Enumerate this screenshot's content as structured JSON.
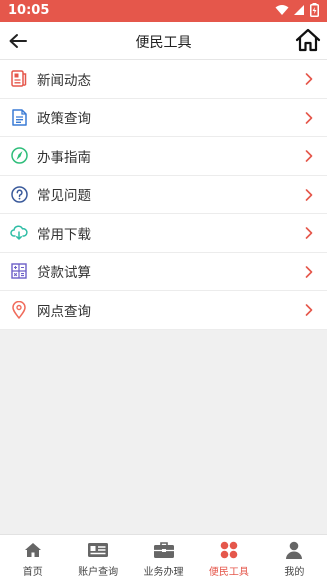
{
  "status": {
    "time": "10:05"
  },
  "header": {
    "title": "便民工具"
  },
  "menu": {
    "items": [
      {
        "label": "新闻动态",
        "icon": "news-icon",
        "color": "#e5574b"
      },
      {
        "label": "政策查询",
        "icon": "document-icon",
        "color": "#3a7bd5"
      },
      {
        "label": "办事指南",
        "icon": "compass-icon",
        "color": "#2ebd7a"
      },
      {
        "label": "常见问题",
        "icon": "question-icon",
        "color": "#3a5a9b"
      },
      {
        "label": "常用下载",
        "icon": "cloud-download-icon",
        "color": "#2ebda5"
      },
      {
        "label": "贷款试算",
        "icon": "calculator-icon",
        "color": "#6c5fc7"
      },
      {
        "label": "网点查询",
        "icon": "location-pin-icon",
        "color": "#f06b5b"
      }
    ]
  },
  "tabs": [
    {
      "label": "首页",
      "icon": "home-icon"
    },
    {
      "label": "账户查询",
      "icon": "id-card-icon"
    },
    {
      "label": "业务办理",
      "icon": "briefcase-icon"
    },
    {
      "label": "便民工具",
      "icon": "tools-icon",
      "active": true
    },
    {
      "label": "我的",
      "icon": "user-icon"
    }
  ],
  "colors": {
    "accent": "#e5574b",
    "arrow": "#e5574b",
    "tab_icon": "#666666"
  }
}
